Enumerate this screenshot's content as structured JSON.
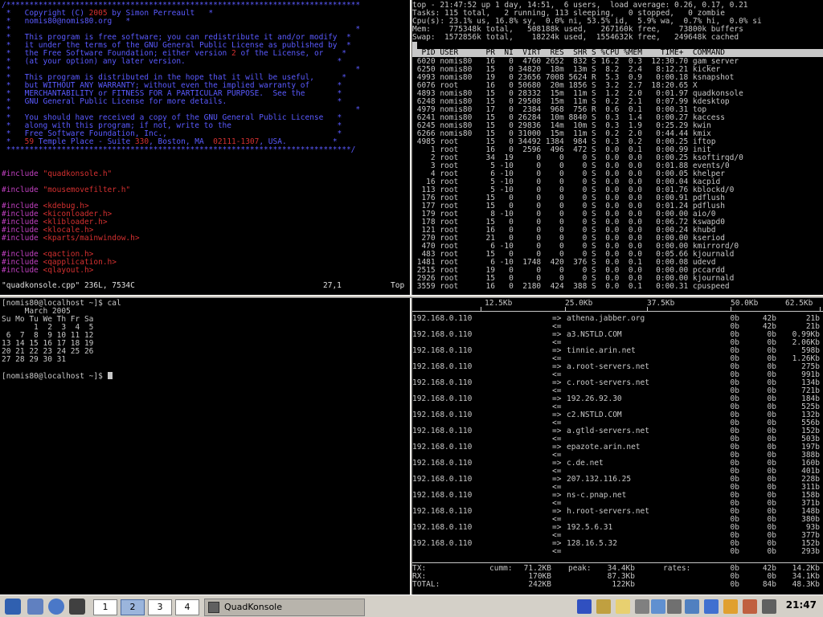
{
  "vim": {
    "lines": [
      {
        "t": "/*****************************************************************************",
        "c": "blue"
      },
      {
        "t": " *   Copyright (C) 2005 by Simon Perreault   *",
        "c": "blue",
        "parts": [
          {
            "t": " *   Copyright (C) ",
            "c": "blue"
          },
          {
            "t": "2005",
            "c": "red"
          },
          {
            "t": " by Simon Perreault   *",
            "c": "blue"
          }
        ]
      },
      {
        "t": " *   nomis80@nomis80.org   *",
        "c": "blue"
      },
      {
        "t": " *                                                                           *",
        "c": "blue"
      },
      {
        "t": " *   This program is free software; you can redistribute it and/or modify  *",
        "c": "blue"
      },
      {
        "t": " *   it under the terms of the GNU General Public License as published by  *",
        "c": "blue"
      },
      {
        "t": " *   the Free Software Foundation; either version 2 of the License, or    *",
        "c": "blue",
        "parts": [
          {
            "t": " *   the Free Software Foundation; either version ",
            "c": "blue"
          },
          {
            "t": "2",
            "c": "red"
          },
          {
            "t": " of the License, or    *",
            "c": "blue"
          }
        ]
      },
      {
        "t": " *   (at your option) any later version.                                 *",
        "c": "blue"
      },
      {
        "t": " *                                                                           *",
        "c": "blue"
      },
      {
        "t": " *   This program is distributed in the hope that it will be useful,      *",
        "c": "blue"
      },
      {
        "t": " *   but WITHOUT ANY WARRANTY; without even the implied warranty of      *",
        "c": "blue"
      },
      {
        "t": " *   MERCHANTABILITY or FITNESS FOR A PARTICULAR PURPOSE.  See the       *",
        "c": "blue"
      },
      {
        "t": " *   GNU General Public License for more details.                        *",
        "c": "blue"
      },
      {
        "t": " *                                                                           *",
        "c": "blue"
      },
      {
        "t": " *   You should have received a copy of the GNU General Public License   *",
        "c": "blue"
      },
      {
        "t": " *   along with this program; if not, write to the                       *",
        "c": "blue"
      },
      {
        "t": " *   Free Software Foundation, Inc.,                                     *",
        "c": "blue"
      },
      {
        "t": " *   59 Temple Place - Suite 330, Boston, MA  02111-1307, USA.          *",
        "c": "blue",
        "parts": [
          {
            "t": " *   ",
            "c": "blue"
          },
          {
            "t": "59",
            "c": "red"
          },
          {
            "t": " Temple Place - Suite ",
            "c": "blue"
          },
          {
            "t": "330",
            "c": "red"
          },
          {
            "t": ", Boston, MA  ",
            "c": "blue"
          },
          {
            "t": "02111-1307",
            "c": "red"
          },
          {
            "t": ", USA.          *",
            "c": "blue"
          }
        ]
      },
      {
        "t": " ***************************************************************************/",
        "c": "blue"
      },
      {
        "t": "",
        "c": "wht"
      },
      {
        "t": "",
        "c": "wht"
      },
      {
        "t": "#include \"quadkonsole.h\"",
        "c": "mag",
        "parts": [
          {
            "t": "#include ",
            "c": "mag"
          },
          {
            "t": "\"quadkonsole.h\"",
            "c": "red"
          }
        ]
      },
      {
        "t": "",
        "c": "wht"
      },
      {
        "t": "#include \"mousemovefilter.h\"",
        "c": "mag",
        "parts": [
          {
            "t": "#include ",
            "c": "mag"
          },
          {
            "t": "\"mousemovefilter.h\"",
            "c": "red"
          }
        ]
      },
      {
        "t": "",
        "c": "wht"
      },
      {
        "t": "#include <kdebug.h>",
        "c": "mag",
        "parts": [
          {
            "t": "#include ",
            "c": "mag"
          },
          {
            "t": "<kdebug.h>",
            "c": "red"
          }
        ]
      },
      {
        "t": "#include <kiconloader.h>",
        "c": "mag",
        "parts": [
          {
            "t": "#include ",
            "c": "mag"
          },
          {
            "t": "<kiconloader.h>",
            "c": "red"
          }
        ]
      },
      {
        "t": "#include <klibloader.h>",
        "c": "mag",
        "parts": [
          {
            "t": "#include ",
            "c": "mag"
          },
          {
            "t": "<klibloader.h>",
            "c": "red"
          }
        ]
      },
      {
        "t": "#include <klocale.h>",
        "c": "mag",
        "parts": [
          {
            "t": "#include ",
            "c": "mag"
          },
          {
            "t": "<klocale.h>",
            "c": "red"
          }
        ]
      },
      {
        "t": "#include <kparts/mainwindow.h>",
        "c": "mag",
        "parts": [
          {
            "t": "#include ",
            "c": "mag"
          },
          {
            "t": "<kparts/mainwindow.h>",
            "c": "red"
          }
        ]
      },
      {
        "t": "",
        "c": "wht"
      },
      {
        "t": "#include <qaction.h>",
        "c": "mag",
        "parts": [
          {
            "t": "#include ",
            "c": "mag"
          },
          {
            "t": "<qaction.h>",
            "c": "red"
          }
        ]
      },
      {
        "t": "#include <qapplication.h>",
        "c": "mag",
        "parts": [
          {
            "t": "#include ",
            "c": "mag"
          },
          {
            "t": "<qapplication.h>",
            "c": "red"
          }
        ]
      },
      {
        "t": "#include <qlayout.h>",
        "c": "mag",
        "parts": [
          {
            "t": "#include ",
            "c": "mag"
          },
          {
            "t": "<qlayout.h>",
            "c": "red"
          }
        ]
      }
    ],
    "status_file": "\"quadkonsole.cpp\" 236L, 7534C",
    "status_pos": "27,1",
    "status_scroll": "Top"
  },
  "top": {
    "summary": [
      "top - 21:47:52 up 1 day, 14:51,  6 users,  load average: 0.26, 0.17, 0.21",
      "Tasks: 115 total,   2 running, 113 sleeping,   0 stopped,   0 zombie",
      "Cpu(s): 23.1% us, 16.8% sy,  0.0% ni, 53.5% id,  5.9% wa,  0.7% hi,  0.0% si",
      "Mem:    775348k total,   508188k used,   267160k free,    73800k buffers",
      "Swap:  1572856k total,    18224k used,  1554632k free,   249648k cached"
    ],
    "header": "  PID USER      PR  NI  VIRT  RES  SHR S %CPU %MEM    TIME+  COMMAND          ",
    "rows": [
      " 6020 nomis80   16   0  4760 2652  832 S 16.2  0.3  12:30.70 gam_server",
      " 6250 nomis80   15   0 34820  18m  13m S  8.2  2.4   8:12.21 kicker",
      " 4993 nomis80   19   0 23656 7008 5624 R  5.3  0.9   0:00.18 ksnapshot",
      " 6076 root      16   0 50680  20m 1856 S  3.2  2.7  18:20.65 X",
      " 4893 nomis80   15   0 28332  15m  11m S  1.2  2.0   0:01.97 quadkonsole",
      " 6248 nomis80   15   0 29508  15m  11m S  0.2  2.1   0:07.99 kdesktop",
      " 4979 nomis80   17   0  2384  968  756 R  0.6  0.1   0:00.31 top",
      " 6241 nomis80   15   0 26284  10m 8840 S  0.3  1.4   0:00.27 kaccess",
      " 6245 nomis80   15   0 29836  14m  10m S  0.3  1.9   0:25.29 kwin",
      " 6266 nomis80   15   0 31000  15m  11m S  0.2  2.0   0:44.44 kmix",
      " 4985 root      15   0 34492 1384  984 S  0.3  0.2   0:00.25 iftop",
      "    1 root      16   0  2596  496  472 S  0.0  0.1   0:00.99 init",
      "    2 root      34  19     0    0    0 S  0.0  0.0   0:00.25 ksoftirqd/0",
      "    3 root       5 -10     0    0    0 S  0.0  0.0   0:01.88 events/0",
      "    4 root       6 -10     0    0    0 S  0.0  0.0   0:00.05 khelper",
      "   16 root       5 -10     0    0    0 S  0.0  0.0   0:00.04 kacpid",
      "  113 root       5 -10     0    0    0 S  0.0  0.0   0:01.76 kblockd/0",
      "  176 root      15   0     0    0    0 S  0.0  0.0   0:00.91 pdflush",
      "  177 root      15   0     0    0    0 S  0.0  0.0   0:01.24 pdflush",
      "  179 root       8 -10     0    0    0 S  0.0  0.0   0:00.00 aio/0",
      "  178 root      15   0     0    0    0 S  0.0  0.0   0:06.72 kswapd0",
      "  121 root      16   0     0    0    0 S  0.0  0.0   0:00.24 khubd",
      "  270 root      21   0     0    0    0 S  0.0  0.0   0:00.00 kseriod",
      "  470 root       6 -10     0    0    0 S  0.0  0.0   0:00.00 kmirrord/0",
      "  483 root      15   0     0    0    0 S  0.0  0.0   0:05.66 kjournald",
      " 1481 root       6 -10  1748  420  376 S  0.0  0.1   0:00.08 udevd",
      " 2515 root      19   0     0    0    0 S  0.0  0.0   0:00.00 pccardd",
      " 2926 root      15   0     0    0    0 S  0.0  0.0   0:00.00 kjournald",
      " 3559 root      16   0  2180  424  388 S  0.0  0.1   0:00.31 cpuspeed"
    ]
  },
  "shell": {
    "prompt1": "[nomis80@localhost ~]$ cal",
    "cal": [
      "     March 2005",
      "Su Mo Tu We Th Fr Sa",
      "       1  2  3  4  5",
      " 6  7  8  9 10 11 12",
      "13 14 15 16 17 18 19",
      "20 21 22 23 24 25 26",
      "27 28 29 30 31"
    ],
    "prompt2": "[nomis80@localhost ~]$ "
  },
  "iftop": {
    "scale": [
      "12.5Kb",
      "25.0Kb",
      "37.5Kb",
      "50.0Kb",
      "62.5Kb"
    ],
    "host": "192.168.0.110",
    "rows": [
      {
        "dst": "athena.jabber.org",
        "o": [
          "0b",
          "42b",
          "21b"
        ],
        "i": [
          "0b",
          "42b",
          "21b"
        ]
      },
      {
        "dst": "a3.NSTLD.COM",
        "o": [
          "0b",
          "0b",
          "0.99Kb"
        ],
        "i": [
          "0b",
          "0b",
          "2.06Kb"
        ]
      },
      {
        "dst": "tinnie.arin.net",
        "o": [
          "0b",
          "0b",
          "598b"
        ],
        "i": [
          "0b",
          "0b",
          "1.26Kb"
        ]
      },
      {
        "dst": "a.root-servers.net",
        "o": [
          "0b",
          "0b",
          "275b"
        ],
        "i": [
          "0b",
          "0b",
          "991b"
        ]
      },
      {
        "dst": "c.root-servers.net",
        "o": [
          "0b",
          "0b",
          "134b"
        ],
        "i": [
          "0b",
          "0b",
          "721b"
        ]
      },
      {
        "dst": "192.26.92.30",
        "o": [
          "0b",
          "0b",
          "184b"
        ],
        "i": [
          "0b",
          "0b",
          "525b"
        ]
      },
      {
        "dst": "c2.NSTLD.COM",
        "o": [
          "0b",
          "0b",
          "132b"
        ],
        "i": [
          "0b",
          "0b",
          "556b"
        ]
      },
      {
        "dst": "a.gtld-servers.net",
        "o": [
          "0b",
          "0b",
          "152b"
        ],
        "i": [
          "0b",
          "0b",
          "503b"
        ]
      },
      {
        "dst": "epazote.arin.net",
        "o": [
          "0b",
          "0b",
          "197b"
        ],
        "i": [
          "0b",
          "0b",
          "388b"
        ]
      },
      {
        "dst": "c.de.net",
        "o": [
          "0b",
          "0b",
          "160b"
        ],
        "i": [
          "0b",
          "0b",
          "401b"
        ]
      },
      {
        "dst": "207.132.116.25",
        "o": [
          "0b",
          "0b",
          "228b"
        ],
        "i": [
          "0b",
          "0b",
          "311b"
        ]
      },
      {
        "dst": "ns-c.pnap.net",
        "o": [
          "0b",
          "0b",
          "158b"
        ],
        "i": [
          "0b",
          "0b",
          "371b"
        ]
      },
      {
        "dst": "h.root-servers.net",
        "o": [
          "0b",
          "0b",
          "148b"
        ],
        "i": [
          "0b",
          "0b",
          "380b"
        ]
      },
      {
        "dst": "192.5.6.31",
        "o": [
          "0b",
          "0b",
          "93b"
        ],
        "i": [
          "0b",
          "0b",
          "377b"
        ]
      },
      {
        "dst": "128.16.5.32",
        "o": [
          "0b",
          "0b",
          "152b"
        ],
        "i": [
          "0b",
          "0b",
          "293b"
        ]
      }
    ],
    "out_arrow": "=>",
    "in_arrow": "<=",
    "footer": [
      {
        "label": "TX:",
        "cumm_label": "cumm:",
        "cumm": "71.2KB",
        "peak_label": "peak:",
        "peak": "34.4Kb",
        "rates_label": "rates:",
        "r": [
          "0b",
          "42b",
          "14.2Kb"
        ]
      },
      {
        "label": "RX:",
        "cumm_label": "",
        "cumm": "170KB",
        "peak_label": "",
        "peak": "87.3Kb",
        "rates_label": "",
        "r": [
          "0b",
          "0b",
          "34.1Kb"
        ]
      },
      {
        "label": "TOTAL:",
        "cumm_label": "",
        "cumm": "242KB",
        "peak_label": "",
        "peak": "122Kb",
        "rates_label": "",
        "r": [
          "0b",
          "84b",
          "48.3Kb"
        ]
      }
    ]
  },
  "taskbar": {
    "desktops": [
      "1",
      "2",
      "3",
      "4"
    ],
    "active_desktop": 1,
    "task_label": "QuadKonsole",
    "clock": "21:47"
  },
  "colors": {
    "vim_comment": "#5a5aff",
    "vim_number": "#d43030",
    "vim_preproc": "#c040c0",
    "terminal_text": "#c8c8c8",
    "panel_bg": "#d4d0c8",
    "desktop_active": "#9bb5dc"
  }
}
